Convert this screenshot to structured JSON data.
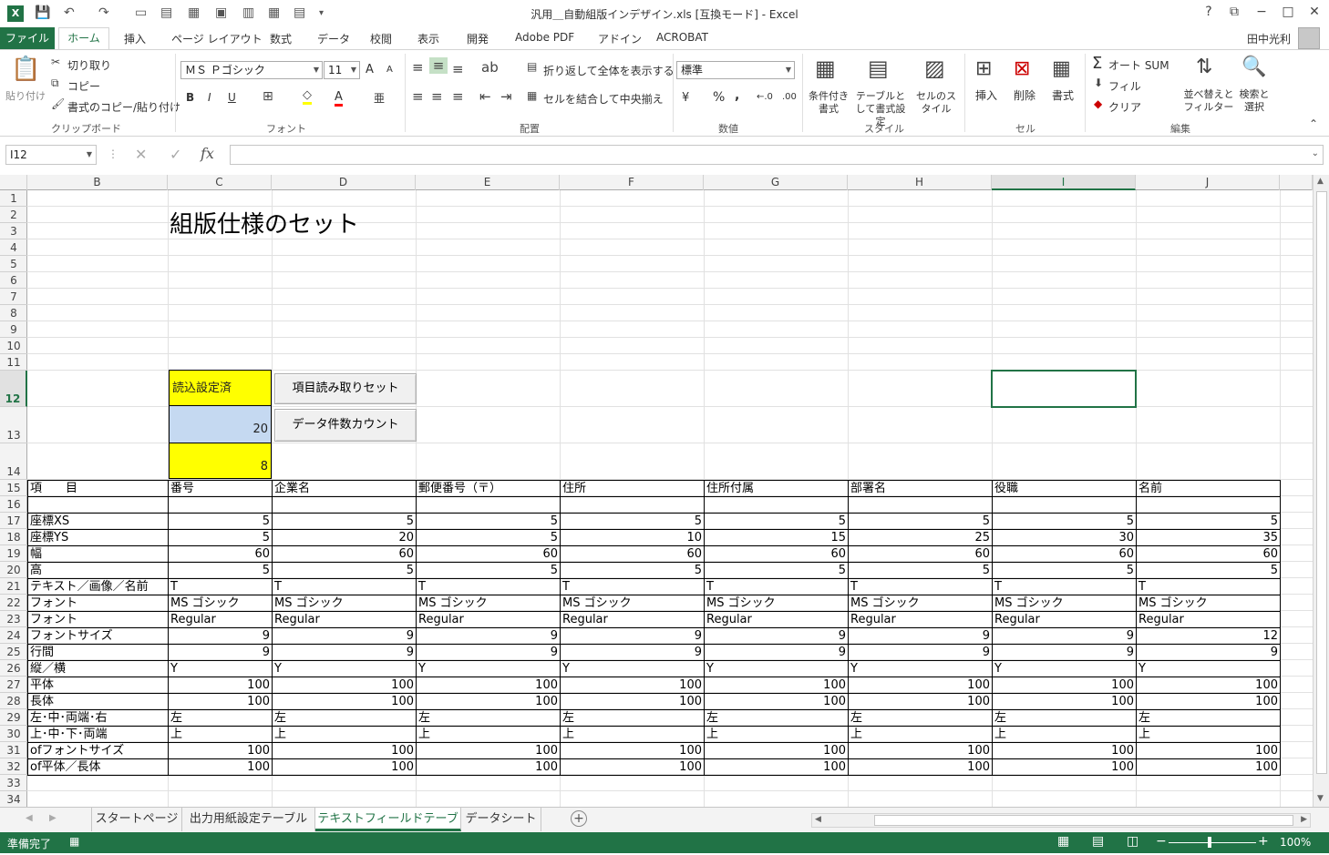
{
  "window": {
    "title": "汎用＿自動組版インデザイン.xls  [互換モード] - Excel",
    "help": "?",
    "controls": [
      "−",
      "□",
      "✕"
    ]
  },
  "tabs": {
    "file": "ファイル",
    "home": "ホーム",
    "items": [
      "挿入",
      "ページ レイアウト",
      "数式",
      "データ",
      "校閲",
      "表示",
      "開発",
      "Adobe PDF",
      "アドイン",
      "ACROBAT"
    ],
    "user": "田中光利"
  },
  "ribbon": {
    "clipboard": {
      "paste": "貼り付け",
      "cut": "切り取り",
      "copy": "コピー",
      "format_painter": "書式のコピー/貼り付け",
      "label": "クリップボード"
    },
    "font": {
      "name": "ＭＳ Ｐゴシック",
      "size": "11",
      "label": "フォント",
      "bold": "B",
      "italic": "I",
      "underline": "U",
      "grow": "A",
      "shrink": "A",
      "fill_icon": "◇",
      "font_color": "A",
      "phonetic": "亜"
    },
    "alignment": {
      "wrap": "折り返して全体を表示する",
      "merge": "セルを結合して中央揃え",
      "label": "配置"
    },
    "number": {
      "format": "標準",
      "label": "数値",
      "currency": "¥",
      "percent": "%",
      "comma": ",",
      "inc_dec": "←.0",
      "dec_dec": ".00"
    },
    "styles": {
      "conditional": "条件付き書式",
      "table": "テーブルとして書式設定",
      "cell": "セルのスタイル",
      "label": "スタイル"
    },
    "cells": {
      "insert": "挿入",
      "delete": "削除",
      "format": "書式",
      "label": "セル"
    },
    "editing": {
      "autosum": "オート SUM",
      "fill": "フィル",
      "clear": "クリア",
      "sort": "並べ替えとフィルター",
      "find": "検索と選択",
      "label": "編集",
      "sigma": "Σ"
    }
  },
  "formula_bar": {
    "namebox": "I12",
    "cancel": "✕",
    "enter": "✓",
    "fx": "fx",
    "value": ""
  },
  "columns": [
    "B",
    "C",
    "D",
    "E",
    "F",
    "G",
    "H",
    "I",
    "J"
  ],
  "rows": [
    "1",
    "2",
    "3",
    "4",
    "5",
    "6",
    "7",
    "8",
    "9",
    "10",
    "11",
    "12",
    "13",
    "14",
    "15",
    "16",
    "17",
    "18",
    "19",
    "20",
    "21",
    "22",
    "23",
    "24",
    "25",
    "26",
    "27",
    "28",
    "29",
    "30",
    "31",
    "32",
    "33",
    "34"
  ],
  "sheet": {
    "title": "組版仕様のセット",
    "status_cell": "読込設定済",
    "count_cell": "20",
    "value_cell": "8",
    "button_read": "項目読み取りセット",
    "button_count": "データ件数カウント",
    "headers": [
      "項　　目",
      "番号",
      "企業名",
      "郵便番号（〒）",
      "住所",
      "住所付属",
      "部署名",
      "役職",
      "名前"
    ],
    "table": [
      {
        "label": "座標XS",
        "vals": [
          "5",
          "5",
          "5",
          "5",
          "5",
          "5",
          "5",
          "5"
        ],
        "num": true
      },
      {
        "label": "座標YS",
        "vals": [
          "5",
          "20",
          "5",
          "10",
          "15",
          "25",
          "30",
          "35"
        ],
        "num": true
      },
      {
        "label": "幅",
        "vals": [
          "60",
          "60",
          "60",
          "60",
          "60",
          "60",
          "60",
          "60"
        ],
        "num": true
      },
      {
        "label": "高",
        "vals": [
          "5",
          "5",
          "5",
          "5",
          "5",
          "5",
          "5",
          "5"
        ],
        "num": true
      },
      {
        "label": "テキスト／画像／名前",
        "vals": [
          "T",
          "T",
          "T",
          "T",
          "T",
          "T",
          "T",
          "T"
        ],
        "num": false
      },
      {
        "label": "フォント",
        "vals": [
          "MS ゴシック",
          "MS ゴシック",
          "MS ゴシック",
          "MS ゴシック",
          "MS ゴシック",
          "MS ゴシック",
          "MS ゴシック",
          "MS ゴシック"
        ],
        "num": false
      },
      {
        "label": "フォント",
        "vals": [
          "Regular",
          "Regular",
          "Regular",
          "Regular",
          "Regular",
          "Regular",
          "Regular",
          "Regular"
        ],
        "num": false
      },
      {
        "label": "フォントサイズ",
        "vals": [
          "9",
          "9",
          "9",
          "9",
          "9",
          "9",
          "9",
          "12"
        ],
        "num": true
      },
      {
        "label": "行間",
        "vals": [
          "9",
          "9",
          "9",
          "9",
          "9",
          "9",
          "9",
          "9"
        ],
        "num": true
      },
      {
        "label": "縦／横",
        "vals": [
          "Y",
          "Y",
          "Y",
          "Y",
          "Y",
          "Y",
          "Y",
          "Y"
        ],
        "num": false
      },
      {
        "label": "平体",
        "vals": [
          "100",
          "100",
          "100",
          "100",
          "100",
          "100",
          "100",
          "100"
        ],
        "num": true
      },
      {
        "label": "長体",
        "vals": [
          "100",
          "100",
          "100",
          "100",
          "100",
          "100",
          "100",
          "100"
        ],
        "num": true
      },
      {
        "label": "左･中･両端･右",
        "vals": [
          "左",
          "左",
          "左",
          "左",
          "左",
          "左",
          "左",
          "左"
        ],
        "num": false
      },
      {
        "label": "上･中･下･両端",
        "vals": [
          "上",
          "上",
          "上",
          "上",
          "上",
          "上",
          "上",
          "上"
        ],
        "num": false
      },
      {
        "label": "ofフォントサイズ",
        "vals": [
          "100",
          "100",
          "100",
          "100",
          "100",
          "100",
          "100",
          "100"
        ],
        "num": true
      },
      {
        "label": "of平体／長体",
        "vals": [
          "100",
          "100",
          "100",
          "100",
          "100",
          "100",
          "100",
          "100"
        ],
        "num": true
      }
    ]
  },
  "sheet_tabs": [
    "スタートページ",
    "出力用紙設定テーブル",
    "テキストフィールドテーブル",
    "データシート"
  ],
  "active_sheet": "テキストフィールドテーブル",
  "status": {
    "ready": "準備完了",
    "zoom": "100%"
  },
  "colors": {
    "accent": "#217346",
    "yellow": "#ffff00",
    "blue": "#c5d9f1"
  }
}
